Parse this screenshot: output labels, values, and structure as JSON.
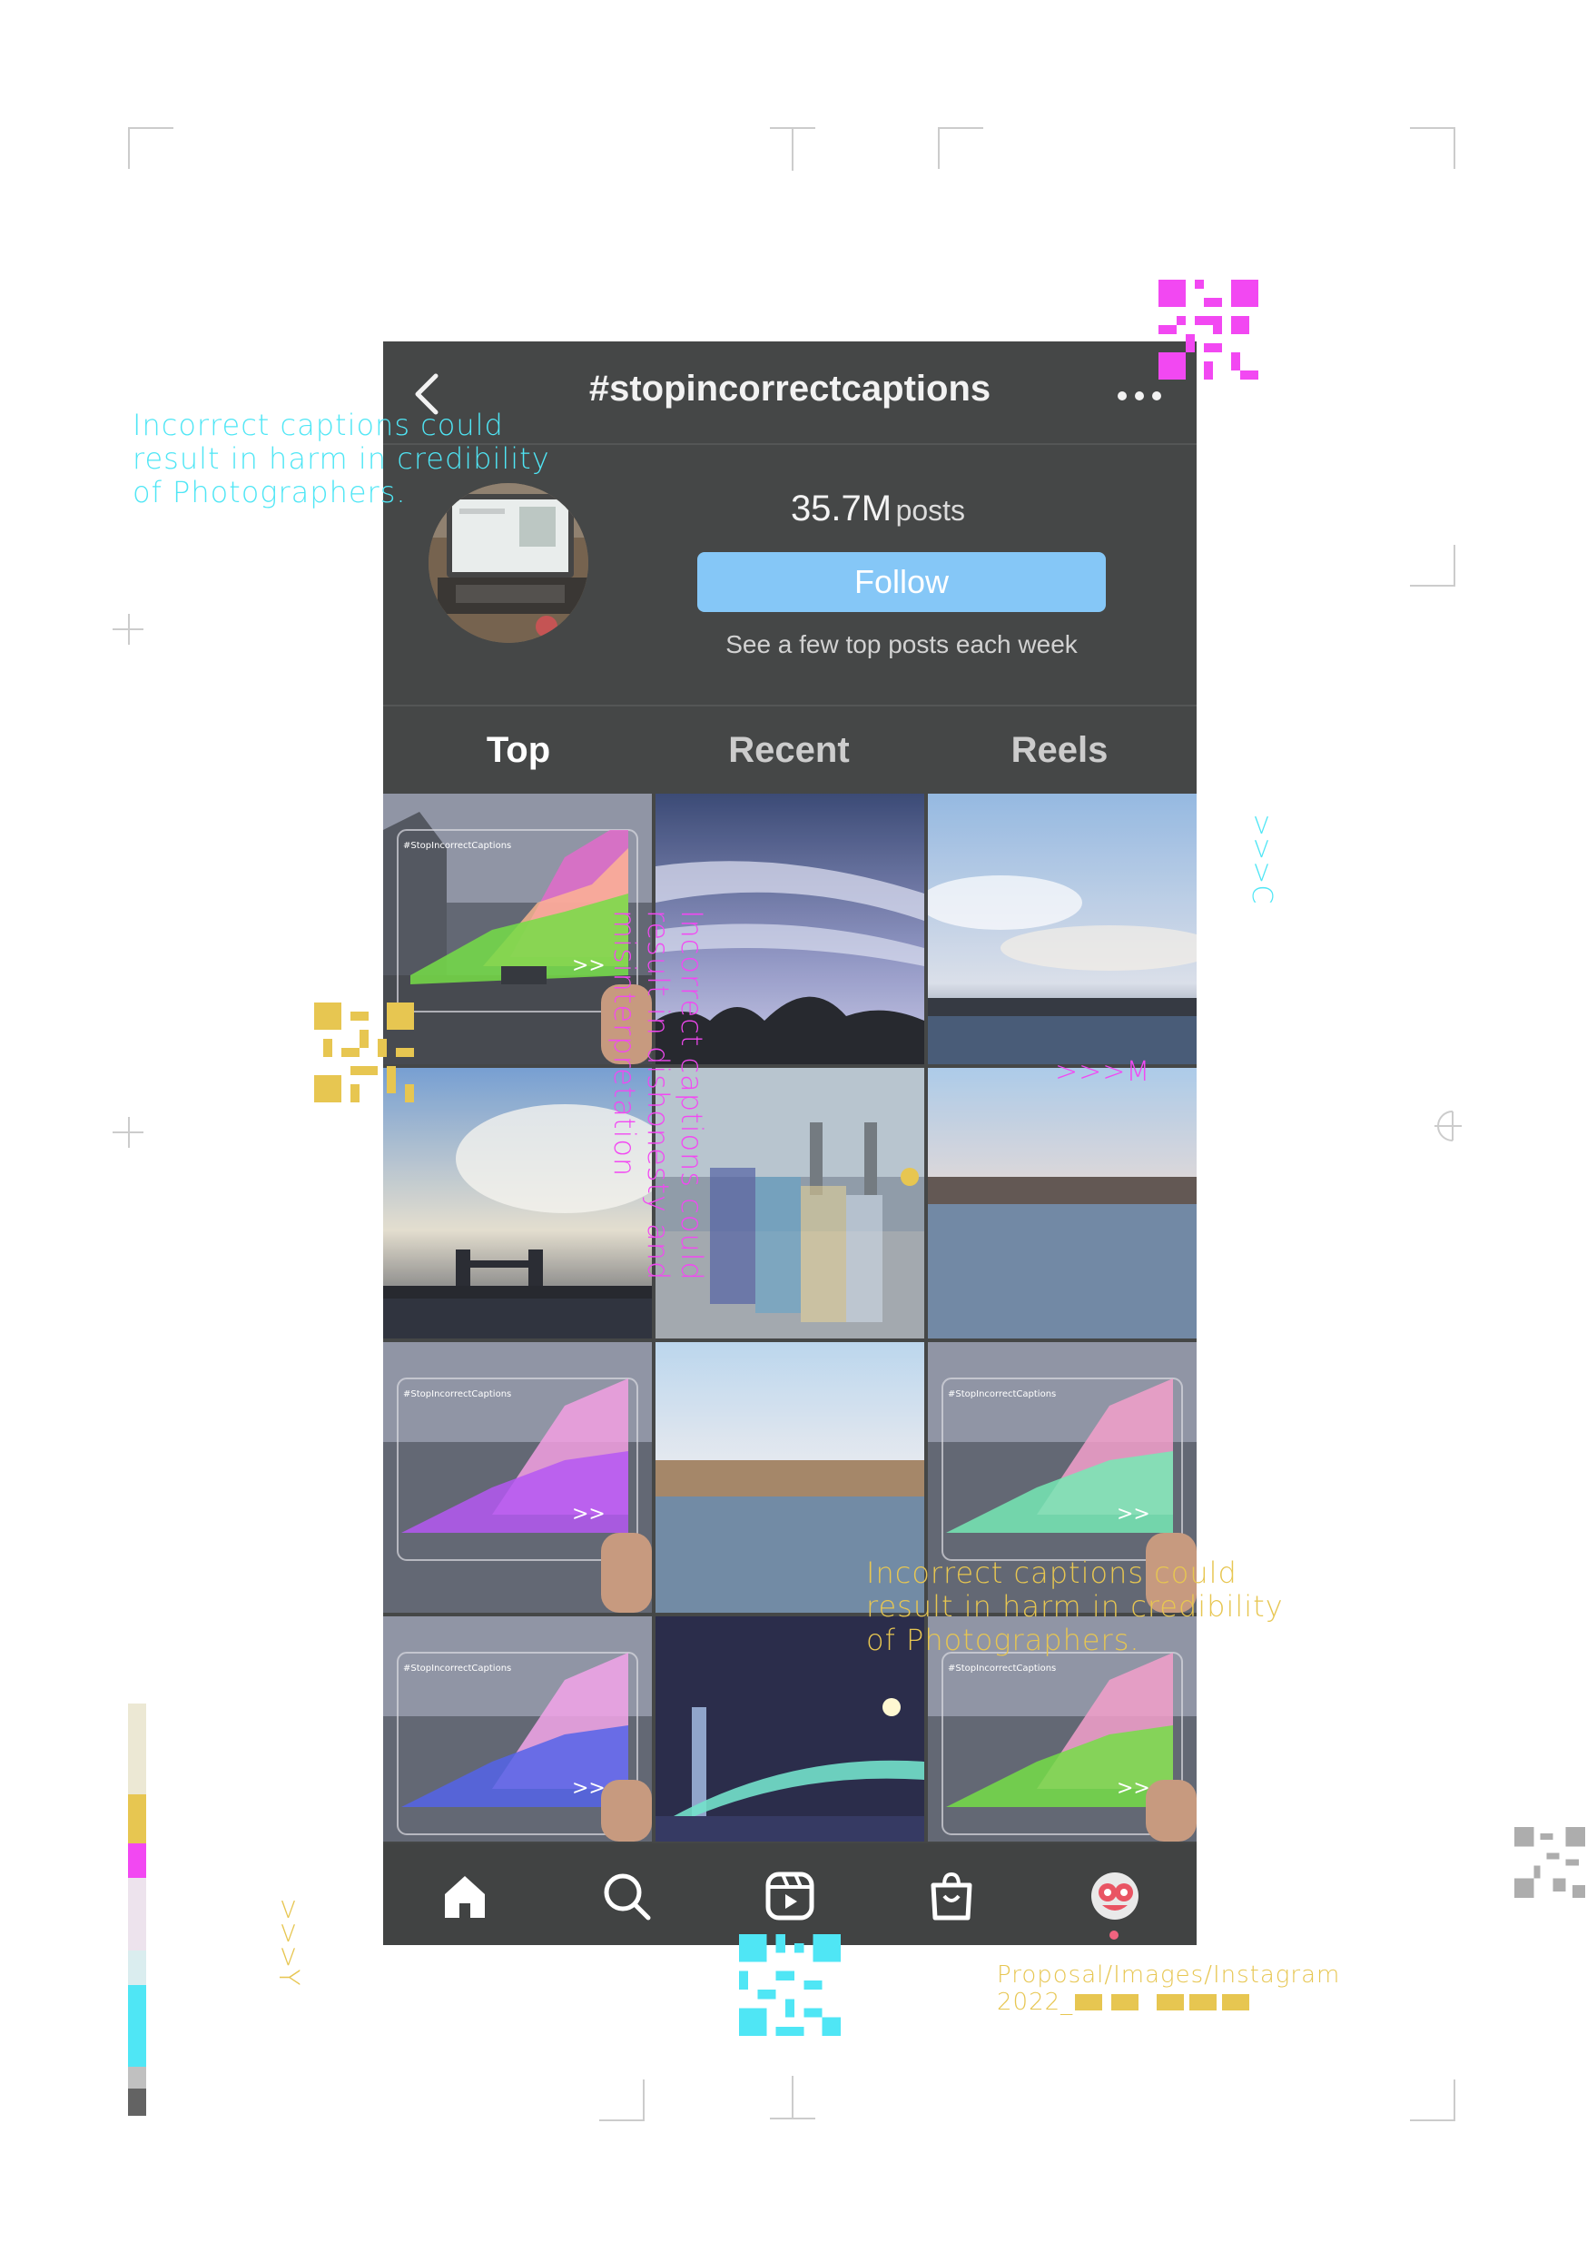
{
  "header": {
    "title": "#stopincorrectcaptions"
  },
  "profile": {
    "post_count": "35.7M",
    "post_label": "posts",
    "follow_label": "Follow",
    "subtext": "See a few top posts each week"
  },
  "tabs": [
    {
      "label": "Top",
      "active": true
    },
    {
      "label": "Recent",
      "active": false
    },
    {
      "label": "Reels",
      "active": false
    }
  ],
  "grid": {
    "overlay_label": "#StopIncorrectCaptions",
    "arrows": ">>"
  },
  "navbar": [
    "home-icon",
    "search-icon",
    "reels-icon",
    "shop-icon",
    "profile-avatar"
  ],
  "annotations": {
    "cyan_caption": "Incorrect captions could\nresult in harm in credibility\nof Photographers.",
    "magenta_vertical": "Incorrect captions could\nresult in dishonesty and\nmisinterpretation",
    "yellow_caption": "Incorrect captions could\nresult in harm in credibility\nof Photographers.",
    "magenta_arrows": ">>>M",
    "cyan_arrows": ">>>C",
    "yellow_arrows": ">>>Y",
    "path_line1": "Proposal/Images/Instagram",
    "path_line2": "2022_"
  },
  "colors": {
    "cyan": "#45e5f5",
    "magenta": "#f23df2",
    "yellow": "#e6c347",
    "follow_blue": "#7ec4f7",
    "phone_bg": "#3a3c3c"
  }
}
